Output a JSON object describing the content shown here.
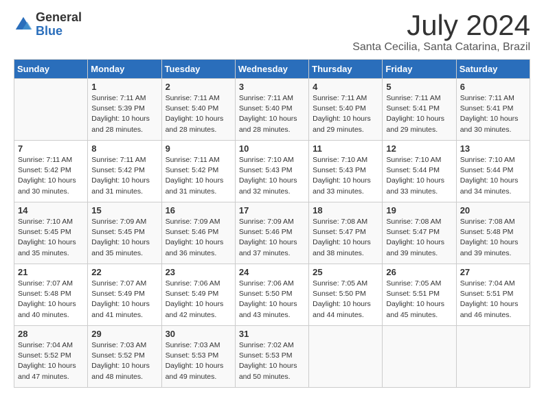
{
  "logo": {
    "general": "General",
    "blue": "Blue"
  },
  "title": "July 2024",
  "location": "Santa Cecilia, Santa Catarina, Brazil",
  "days_of_week": [
    "Sunday",
    "Monday",
    "Tuesday",
    "Wednesday",
    "Thursday",
    "Friday",
    "Saturday"
  ],
  "weeks": [
    [
      {
        "day": "",
        "info": ""
      },
      {
        "day": "1",
        "info": "Sunrise: 7:11 AM\nSunset: 5:39 PM\nDaylight: 10 hours\nand 28 minutes."
      },
      {
        "day": "2",
        "info": "Sunrise: 7:11 AM\nSunset: 5:40 PM\nDaylight: 10 hours\nand 28 minutes."
      },
      {
        "day": "3",
        "info": "Sunrise: 7:11 AM\nSunset: 5:40 PM\nDaylight: 10 hours\nand 28 minutes."
      },
      {
        "day": "4",
        "info": "Sunrise: 7:11 AM\nSunset: 5:40 PM\nDaylight: 10 hours\nand 29 minutes."
      },
      {
        "day": "5",
        "info": "Sunrise: 7:11 AM\nSunset: 5:41 PM\nDaylight: 10 hours\nand 29 minutes."
      },
      {
        "day": "6",
        "info": "Sunrise: 7:11 AM\nSunset: 5:41 PM\nDaylight: 10 hours\nand 30 minutes."
      }
    ],
    [
      {
        "day": "7",
        "info": "Sunrise: 7:11 AM\nSunset: 5:42 PM\nDaylight: 10 hours\nand 30 minutes."
      },
      {
        "day": "8",
        "info": "Sunrise: 7:11 AM\nSunset: 5:42 PM\nDaylight: 10 hours\nand 31 minutes."
      },
      {
        "day": "9",
        "info": "Sunrise: 7:11 AM\nSunset: 5:42 PM\nDaylight: 10 hours\nand 31 minutes."
      },
      {
        "day": "10",
        "info": "Sunrise: 7:10 AM\nSunset: 5:43 PM\nDaylight: 10 hours\nand 32 minutes."
      },
      {
        "day": "11",
        "info": "Sunrise: 7:10 AM\nSunset: 5:43 PM\nDaylight: 10 hours\nand 33 minutes."
      },
      {
        "day": "12",
        "info": "Sunrise: 7:10 AM\nSunset: 5:44 PM\nDaylight: 10 hours\nand 33 minutes."
      },
      {
        "day": "13",
        "info": "Sunrise: 7:10 AM\nSunset: 5:44 PM\nDaylight: 10 hours\nand 34 minutes."
      }
    ],
    [
      {
        "day": "14",
        "info": "Sunrise: 7:10 AM\nSunset: 5:45 PM\nDaylight: 10 hours\nand 35 minutes."
      },
      {
        "day": "15",
        "info": "Sunrise: 7:09 AM\nSunset: 5:45 PM\nDaylight: 10 hours\nand 35 minutes."
      },
      {
        "day": "16",
        "info": "Sunrise: 7:09 AM\nSunset: 5:46 PM\nDaylight: 10 hours\nand 36 minutes."
      },
      {
        "day": "17",
        "info": "Sunrise: 7:09 AM\nSunset: 5:46 PM\nDaylight: 10 hours\nand 37 minutes."
      },
      {
        "day": "18",
        "info": "Sunrise: 7:08 AM\nSunset: 5:47 PM\nDaylight: 10 hours\nand 38 minutes."
      },
      {
        "day": "19",
        "info": "Sunrise: 7:08 AM\nSunset: 5:47 PM\nDaylight: 10 hours\nand 39 minutes."
      },
      {
        "day": "20",
        "info": "Sunrise: 7:08 AM\nSunset: 5:48 PM\nDaylight: 10 hours\nand 39 minutes."
      }
    ],
    [
      {
        "day": "21",
        "info": "Sunrise: 7:07 AM\nSunset: 5:48 PM\nDaylight: 10 hours\nand 40 minutes."
      },
      {
        "day": "22",
        "info": "Sunrise: 7:07 AM\nSunset: 5:49 PM\nDaylight: 10 hours\nand 41 minutes."
      },
      {
        "day": "23",
        "info": "Sunrise: 7:06 AM\nSunset: 5:49 PM\nDaylight: 10 hours\nand 42 minutes."
      },
      {
        "day": "24",
        "info": "Sunrise: 7:06 AM\nSunset: 5:50 PM\nDaylight: 10 hours\nand 43 minutes."
      },
      {
        "day": "25",
        "info": "Sunrise: 7:05 AM\nSunset: 5:50 PM\nDaylight: 10 hours\nand 44 minutes."
      },
      {
        "day": "26",
        "info": "Sunrise: 7:05 AM\nSunset: 5:51 PM\nDaylight: 10 hours\nand 45 minutes."
      },
      {
        "day": "27",
        "info": "Sunrise: 7:04 AM\nSunset: 5:51 PM\nDaylight: 10 hours\nand 46 minutes."
      }
    ],
    [
      {
        "day": "28",
        "info": "Sunrise: 7:04 AM\nSunset: 5:52 PM\nDaylight: 10 hours\nand 47 minutes."
      },
      {
        "day": "29",
        "info": "Sunrise: 7:03 AM\nSunset: 5:52 PM\nDaylight: 10 hours\nand 48 minutes."
      },
      {
        "day": "30",
        "info": "Sunrise: 7:03 AM\nSunset: 5:53 PM\nDaylight: 10 hours\nand 49 minutes."
      },
      {
        "day": "31",
        "info": "Sunrise: 7:02 AM\nSunset: 5:53 PM\nDaylight: 10 hours\nand 50 minutes."
      },
      {
        "day": "",
        "info": ""
      },
      {
        "day": "",
        "info": ""
      },
      {
        "day": "",
        "info": ""
      }
    ]
  ]
}
